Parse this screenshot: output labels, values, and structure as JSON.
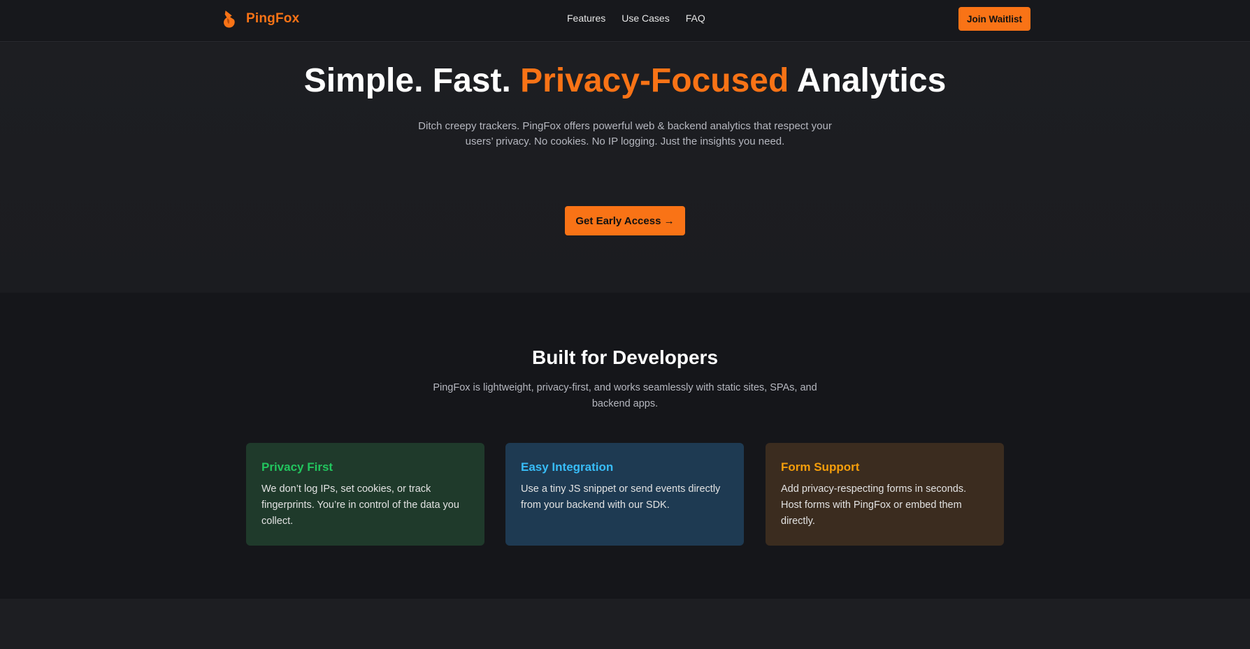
{
  "brand": {
    "name": "PingFox",
    "accent": "#f97316"
  },
  "nav": {
    "items": [
      "Features",
      "Use Cases",
      "FAQ"
    ],
    "join_waitlist": "Join Waitlist"
  },
  "hero": {
    "title_part1": "Simple. Fast. ",
    "title_accent": "Privacy-Focused",
    "title_part2": " Analytics",
    "subtitle": "Ditch creepy trackers. PingFox offers powerful web & backend analytics that respect your users’ privacy. No cookies. No IP logging. Just the insights you need.",
    "cta_label": "Get Early Access →"
  },
  "dev": {
    "title": "Built for Developers",
    "subtitle": "PingFox is lightweight, privacy-first, and works seamlessly with static sites, SPAs, and backend apps."
  },
  "cards": [
    {
      "title": "Privacy First",
      "text": "We don’t log IPs, set cookies, or track fingerprints. You’re in control of the data you collect.",
      "title_color": "#22c55e",
      "bg": "#1f3a2b"
    },
    {
      "title": "Easy Integration",
      "text": "Use a tiny JS snippet or send events directly from your backend with our SDK.",
      "title_color": "#38bdf8",
      "bg": "#1e3a52"
    },
    {
      "title": "Form Support",
      "text": "Add privacy-respecting forms in seconds. Host forms with PingFox or embed them directly.",
      "title_color": "#f59e0b",
      "bg": "#3b2c1f"
    }
  ]
}
